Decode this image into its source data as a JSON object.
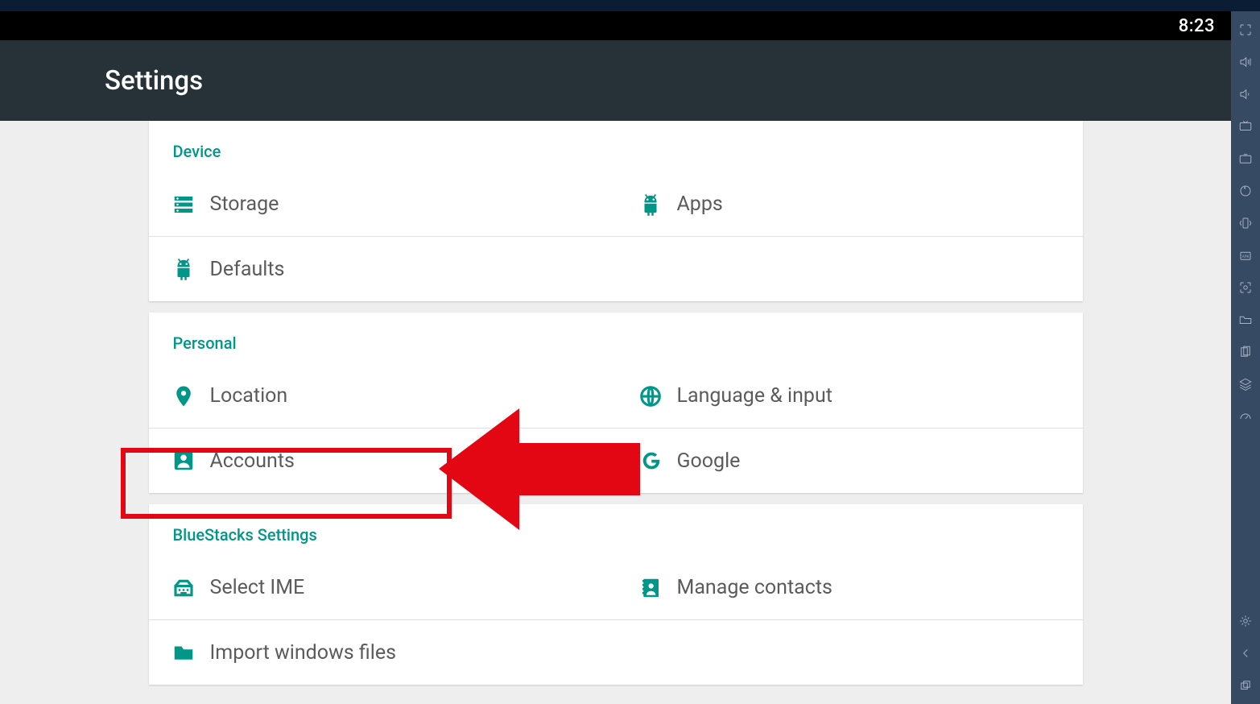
{
  "status": {
    "time": "8:23"
  },
  "header": {
    "title": "Settings"
  },
  "highlight": {
    "target": "accounts"
  },
  "cards": [
    {
      "title": "Device",
      "rows": [
        {
          "left": {
            "id": "storage",
            "label": "Storage",
            "icon": "storage-icon"
          },
          "right": {
            "id": "apps",
            "label": "Apps",
            "icon": "android-icon"
          }
        },
        {
          "left": {
            "id": "defaults",
            "label": "Defaults",
            "icon": "android-icon"
          },
          "right": null
        }
      ]
    },
    {
      "title": "Personal",
      "rows": [
        {
          "left": {
            "id": "location",
            "label": "Location",
            "icon": "location-icon"
          },
          "right": {
            "id": "language",
            "label": "Language & input",
            "icon": "globe-icon"
          }
        },
        {
          "left": {
            "id": "accounts",
            "label": "Accounts",
            "icon": "person-icon"
          },
          "right": {
            "id": "google",
            "label": "Google",
            "icon": "google-icon"
          }
        }
      ]
    },
    {
      "title": "BlueStacks Settings",
      "rows": [
        {
          "left": {
            "id": "select-ime",
            "label": "Select IME",
            "icon": "keyboard-icon"
          },
          "right": {
            "id": "contacts",
            "label": "Manage contacts",
            "icon": "contacts-icon"
          }
        },
        {
          "left": {
            "id": "import-files",
            "label": "Import windows files",
            "icon": "folder-icon"
          },
          "right": null
        }
      ]
    }
  ],
  "sidebar_icons": [
    "fullscreen-icon",
    "volume-up-icon",
    "volume-down-icon",
    "keymap-icon",
    "media-icon",
    "rotate-icon",
    "shake-icon",
    "apk-icon",
    "camera-icon",
    "folder-icon",
    "copy-icon",
    "layers-icon",
    "speed-icon"
  ],
  "sidebar_bottom": [
    "settings-icon",
    "back-icon",
    "multi-icon"
  ]
}
